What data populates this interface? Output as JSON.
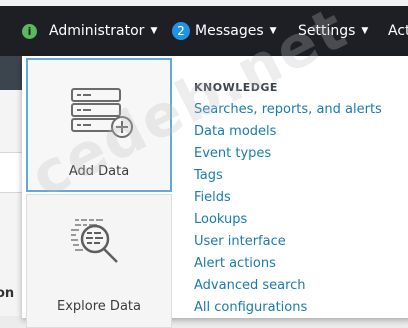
{
  "navbar": {
    "info_icon": "i",
    "account": "Administrator",
    "messages_count": "2",
    "messages": "Messages",
    "settings": "Settings",
    "activity_partial": "Act"
  },
  "background": {
    "partial_text": "on"
  },
  "dropdown": {
    "tiles": [
      {
        "label": "Add Data",
        "icon": "database-add-icon"
      },
      {
        "label": "Explore Data",
        "icon": "explore-data-icon"
      }
    ],
    "section_heading": "KNOWLEDGE",
    "links": [
      "Searches, reports, and alerts",
      "Data models",
      "Event types",
      "Tags",
      "Fields",
      "Lookups",
      "User interface",
      "Alert actions",
      "Advanced search",
      "All configurations"
    ]
  },
  "watermark": "cedeb.net",
  "colors": {
    "navbar_bg": "#1d1f25",
    "appbar_bg": "#3c444d",
    "link": "#1a7bb0",
    "tile_border_active": "#5fa8e0",
    "badge": "#1e93e8",
    "info_green": "#5cb85c"
  }
}
